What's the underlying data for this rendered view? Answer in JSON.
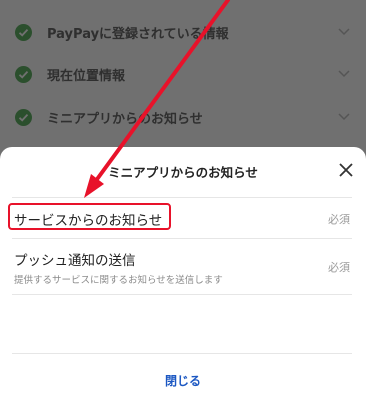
{
  "background_list": {
    "items": [
      {
        "label": "PayPayに登録されている情報"
      },
      {
        "label": "現在位置情報"
      },
      {
        "label": "ミニアプリからのお知らせ"
      }
    ]
  },
  "sheet": {
    "title": "ミニアプリからのお知らせ",
    "items": [
      {
        "title": "サービスからのお知らせ",
        "required": "必須"
      },
      {
        "title": "プッシュ通知の送信",
        "subtitle": "提供するサービスに関するお知らせを送信します",
        "required": "必須"
      }
    ],
    "close_label": "閉じる"
  },
  "colors": {
    "annotation": "#e8122a",
    "link": "#1b57c2"
  }
}
